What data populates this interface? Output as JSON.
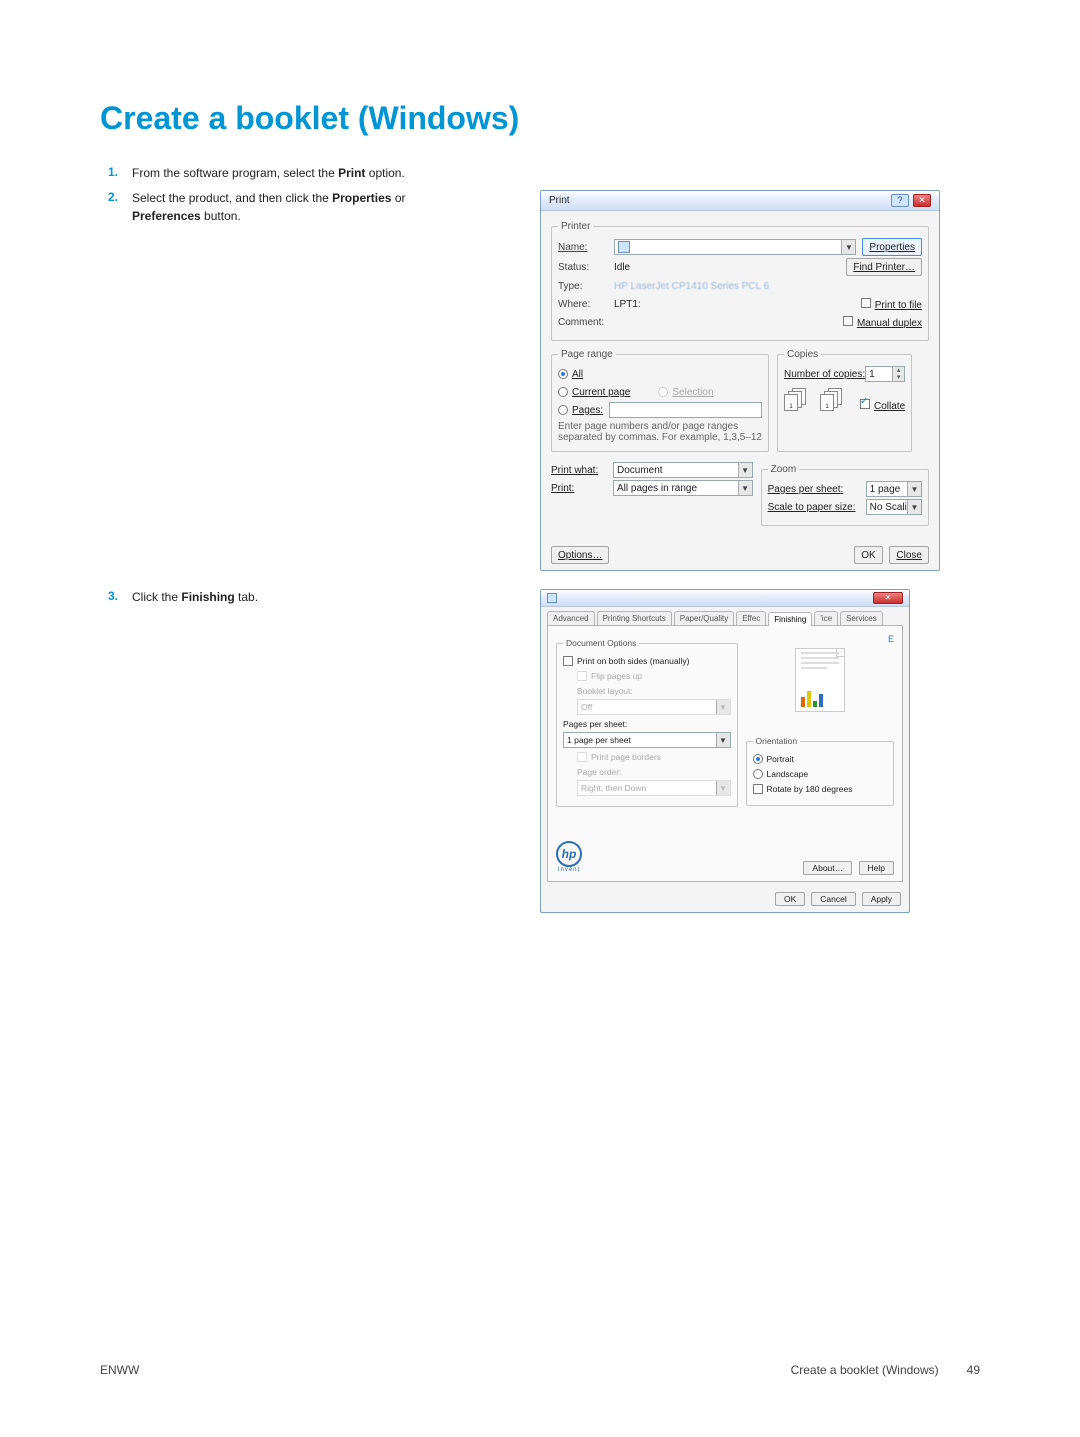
{
  "title": "Create a booklet (Windows)",
  "steps": [
    {
      "num": "1.",
      "pre": "From the software program, select the ",
      "bold": "Print",
      "post": " option."
    },
    {
      "num": "2.",
      "pre": "Select the product, and then click the ",
      "bold": "Properties",
      "mid": " or ",
      "bold2": "Preferences",
      "post": " button."
    },
    {
      "num": "3.",
      "pre": "Click the ",
      "bold": "Finishing",
      "post": " tab."
    }
  ],
  "printDialog": {
    "title": "Print",
    "printerLegend": "Printer",
    "nameLabel": "Name:",
    "statusLabel": "Status:",
    "statusValue": "Idle",
    "typeLabel": "Type:",
    "typeValue": "HP LaserJet CP1410 Series PCL 6",
    "whereLabel": "Where:",
    "whereValue": "LPT1:",
    "commentLabel": "Comment:",
    "propertiesBtn": "Properties",
    "findPrinterBtn": "Find Printer…",
    "printToFile": "Print to file",
    "manualDuplex": "Manual duplex",
    "pageRangeLegend": "Page range",
    "allRadio": "All",
    "currentRadio": "Current page",
    "selectionRadio": "Selection",
    "pagesRadio": "Pages:",
    "pagesHint1": "Enter page numbers and/or page ranges",
    "pagesHint2": "separated by commas. For example, 1,3,5–12",
    "copiesLegend": "Copies",
    "numCopiesLabel": "Number of copies:",
    "numCopiesValue": "1",
    "collateLabel": "Collate",
    "printWhatLabel": "Print what:",
    "printWhatValue": "Document",
    "printLabel": "Print:",
    "printValue": "All pages in range",
    "zoomLegend": "Zoom",
    "ppsLabel": "Pages per sheet:",
    "ppsValue": "1 page",
    "scaleLabel": "Scale to paper size:",
    "scaleValue": "No Scaling",
    "optionsBtn": "Options…",
    "okBtn": "OK",
    "closeBtn": "Close"
  },
  "propDialog": {
    "tabs": [
      "Advanced",
      "Printing Shortcuts",
      "Paper/Quality",
      "Effec",
      "Finishing",
      "'ice",
      "Services"
    ],
    "activeTabIndex": 4,
    "docOptions": "Document Options",
    "printBothSides": "Print on both sides (manually)",
    "flipPages": "Flip pages up",
    "bookletLayout": "Booklet layout:",
    "bookletValue": "Off",
    "ppsLabel": "Pages per sheet:",
    "ppsValue": "1 page per sheet",
    "printBorders": "Print page borders",
    "pageOrder": "Page order:",
    "pageOrderValue": "Right, then Down",
    "orientationLegend": "Orientation",
    "portrait": "Portrait",
    "landscape": "Landscape",
    "rotate180": "Rotate by 180 degrees",
    "aboutBtn": "About…",
    "helpBtn": "Help",
    "okBtn": "OK",
    "cancelBtn": "Cancel",
    "applyBtn": "Apply",
    "hp": "hp",
    "invent": "Invent"
  },
  "footer": {
    "left": "ENWW",
    "rightText": "Create a booklet (Windows)",
    "pageNum": "49"
  }
}
